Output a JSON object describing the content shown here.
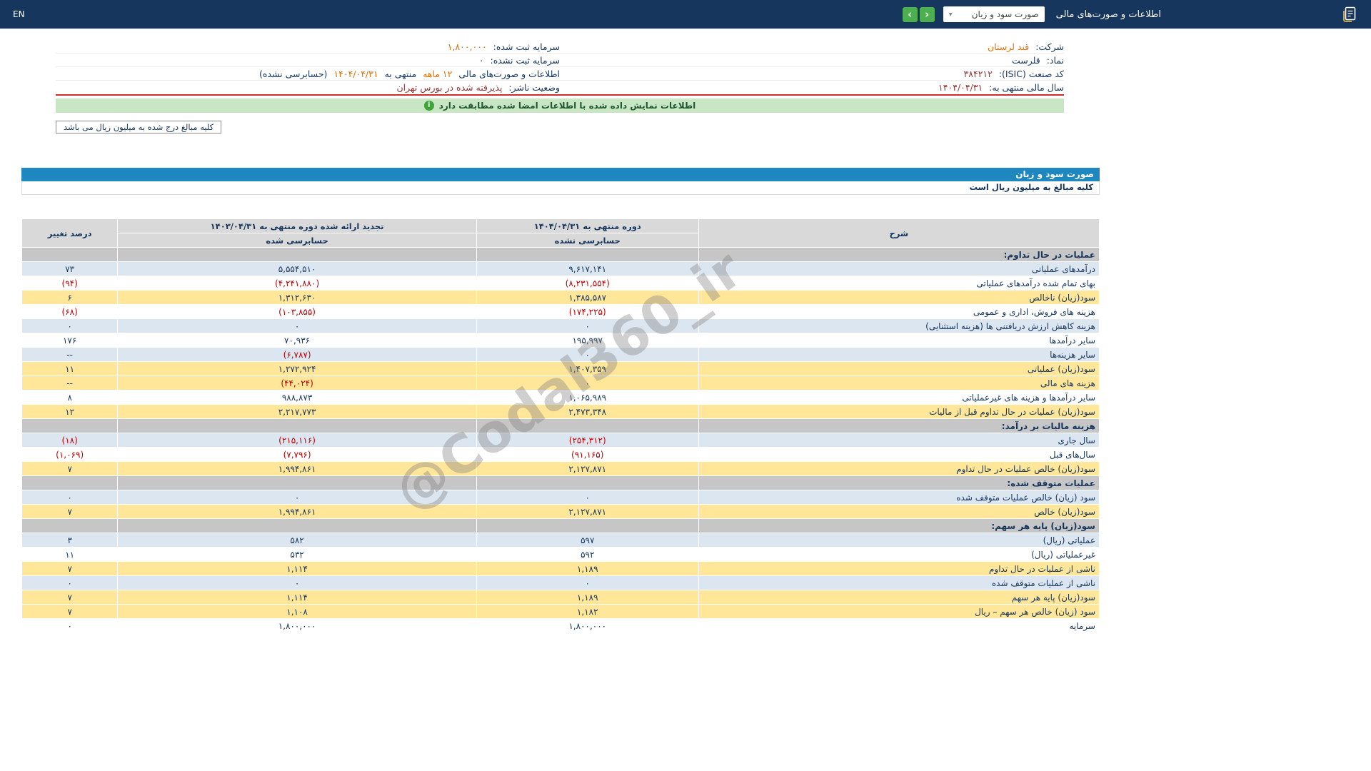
{
  "topbar": {
    "language": "EN",
    "title": "اطلاعات و صورت‌های مالی",
    "statement_dropdown": {
      "selected": "صورت سود و زیان",
      "caret": "▾"
    },
    "nav": {
      "next": "‹",
      "prev": "›"
    }
  },
  "company_info": {
    "right": [
      {
        "label": "شرکت:",
        "value": "قند لرستان"
      },
      {
        "label": "نماد:",
        "value": "قلرست"
      },
      {
        "label": "کد صنعت (ISIC):",
        "value": "۳۸۴۲۱۲"
      },
      {
        "label": "سال مالی منتهی به:",
        "value": "۱۴۰۴/۰۴/۳۱"
      }
    ],
    "left": [
      {
        "label": "سرمایه ثبت شده:",
        "value": "۱,۸۰۰,۰۰۰"
      },
      {
        "label": "سرمایه ثبت نشده:",
        "value": "۰"
      },
      {
        "label": "اطلاعات و صورت‌های مالی",
        "months": "۱۲ ماهه",
        "connector": "منتهی به",
        "date": "۱۴۰۴/۰۴/۳۱",
        "audit_note": "(حسابرسی نشده)"
      },
      {
        "label": "وضعیت ناشر:",
        "value": "پذیرفته شده در بورس تهران"
      }
    ]
  },
  "signature_banner": {
    "text": "اطلاعات نمایش داده شده با اطلاعات امضا شده مطابقت دارد",
    "icon": "info-icon"
  },
  "amounts_note": "کلیه مبالغ درج شده به میلیون ریال می باشد",
  "statement": {
    "title": "صورت سود و زیان",
    "caption": "کلیه مبالغ به میلیون ریال است",
    "headers": {
      "description": "شرح",
      "current_period": "دوره منتهی به ۱۴۰۴/۰۴/۳۱",
      "current_audit": "حسابرسی نشده",
      "prior_period": "تجدید ارائه شده دوره منتهی به ۱۴۰۳/۰۴/۳۱",
      "prior_audit": "حسابرسی شده",
      "change": "درصد تغییر"
    },
    "rows": [
      {
        "label": "عملیات در حال تداوم:",
        "style": "section"
      },
      {
        "label": "درآمدهای عملیاتی",
        "current": "۹,۶۱۷,۱۴۱",
        "prior": "۵,۵۵۴,۵۱۰",
        "change": "۷۳",
        "style": "blue"
      },
      {
        "label": "بهای تمام شده درآمدهای عملیاتی",
        "current": "(۸,۲۳۱,۵۵۴)",
        "prior": "(۴,۲۴۱,۸۸۰)",
        "change": "(۹۴)",
        "style": "white"
      },
      {
        "label": "سود(زیان) ناخالص",
        "current": "۱,۳۸۵,۵۸۷",
        "prior": "۱,۳۱۲,۶۳۰",
        "change": "۶",
        "style": "yellow"
      },
      {
        "label": "هزینه های فروش، اداری و عمومی",
        "current": "(۱۷۴,۲۲۵)",
        "prior": "(۱۰۳,۸۵۵)",
        "change": "(۶۸)",
        "style": "white"
      },
      {
        "label": "هزینه کاهش ارزش دریافتنی ها (هزینه استثنایی)",
        "current": "۰",
        "prior": "۰",
        "change": "۰",
        "style": "blue"
      },
      {
        "label": "سایر درآمدها",
        "current": "۱۹۵,۹۹۷",
        "prior": "۷۰,۹۳۶",
        "change": "۱۷۶",
        "style": "white"
      },
      {
        "label": "سایر هزینه‌ها",
        "current": "۰",
        "prior": "(۶,۷۸۷)",
        "change": "--",
        "style": "blue"
      },
      {
        "label": "سود(زیان) عملیاتی",
        "current": "۱,۴۰۷,۳۵۹",
        "prior": "۱,۲۷۲,۹۲۴",
        "change": "۱۱",
        "style": "yellow"
      },
      {
        "label": "هزینه های مالی",
        "current": "۰",
        "prior": "(۴۴,۰۲۴)",
        "change": "--",
        "style": "yellow"
      },
      {
        "label": "سایر درآمدها و هزینه های غیرعملیاتی",
        "current": "۱,۰۶۵,۹۸۹",
        "prior": "۹۸۸,۸۷۳",
        "change": "۸",
        "style": "white"
      },
      {
        "label": "سود(زیان) عملیات در حال تداوم قبل از مالیات",
        "current": "۲,۴۷۳,۳۴۸",
        "prior": "۲,۲۱۷,۷۷۳",
        "change": "۱۲",
        "style": "yellow"
      },
      {
        "label": "هزینه مالیات بر درآمد:",
        "style": "section"
      },
      {
        "label": "سال جاری",
        "current": "(۲۵۴,۳۱۲)",
        "prior": "(۲۱۵,۱۱۶)",
        "change": "(۱۸)",
        "style": "blue"
      },
      {
        "label": "سال‌های قبل",
        "current": "(۹۱,۱۶۵)",
        "prior": "(۷,۷۹۶)",
        "change": "(۱,۰۶۹)",
        "style": "white"
      },
      {
        "label": "سود(زیان) خالص عملیات در حال تداوم",
        "current": "۲,۱۲۷,۸۷۱",
        "prior": "۱,۹۹۴,۸۶۱",
        "change": "۷",
        "style": "yellow"
      },
      {
        "label": "عملیات متوقف شده:",
        "style": "section"
      },
      {
        "label": "سود (زیان) خالص عملیات متوقف شده",
        "current": "۰",
        "prior": "۰",
        "change": "۰",
        "style": "blue"
      },
      {
        "label": "سود(زیان) خالص",
        "current": "۲,۱۲۷,۸۷۱",
        "prior": "۱,۹۹۴,۸۶۱",
        "change": "۷",
        "style": "yellow"
      },
      {
        "label": "سود(زیان) پایه هر سهم:",
        "style": "section"
      },
      {
        "label": "عملیاتی (ریال)",
        "current": "۵۹۷",
        "prior": "۵۸۲",
        "change": "۳",
        "style": "blue"
      },
      {
        "label": "غیرعملیاتی (ریال)",
        "current": "۵۹۲",
        "prior": "۵۳۲",
        "change": "۱۱",
        "style": "white"
      },
      {
        "label": "ناشی از عملیات در حال تداوم",
        "current": "۱,۱۸۹",
        "prior": "۱,۱۱۴",
        "change": "۷",
        "style": "yellow"
      },
      {
        "label": "ناشی از عملیات متوقف شده",
        "current": "۰",
        "prior": "۰",
        "change": "۰",
        "style": "blue"
      },
      {
        "label": "سود(زیان) پایه هر سهم",
        "current": "۱,۱۸۹",
        "prior": "۱,۱۱۴",
        "change": "۷",
        "style": "yellow"
      },
      {
        "label": "سود (زیان) خالص هر سهم – ریال",
        "current": "۱,۱۸۲",
        "prior": "۱,۱۰۸",
        "change": "۷",
        "style": "yellow"
      },
      {
        "label": "سرمایه",
        "current": "۱,۸۰۰,۰۰۰",
        "prior": "۱,۸۰۰,۰۰۰",
        "change": "۰",
        "style": "white"
      }
    ]
  },
  "watermark": "@Codal360_ir",
  "colors": {
    "topbar_bg": "#17365D",
    "statement_header_bg": "#1F87C0",
    "nav_button_green": "#4CAF50",
    "banner_bg": "#C8E6C3",
    "row_blue": "#DCE6F1",
    "row_yellow": "#FFE699",
    "row_section": "#C6C6C6",
    "negative_red": "#C00000",
    "link_orange": "#E2710C",
    "divider_red": "#C9302C"
  }
}
